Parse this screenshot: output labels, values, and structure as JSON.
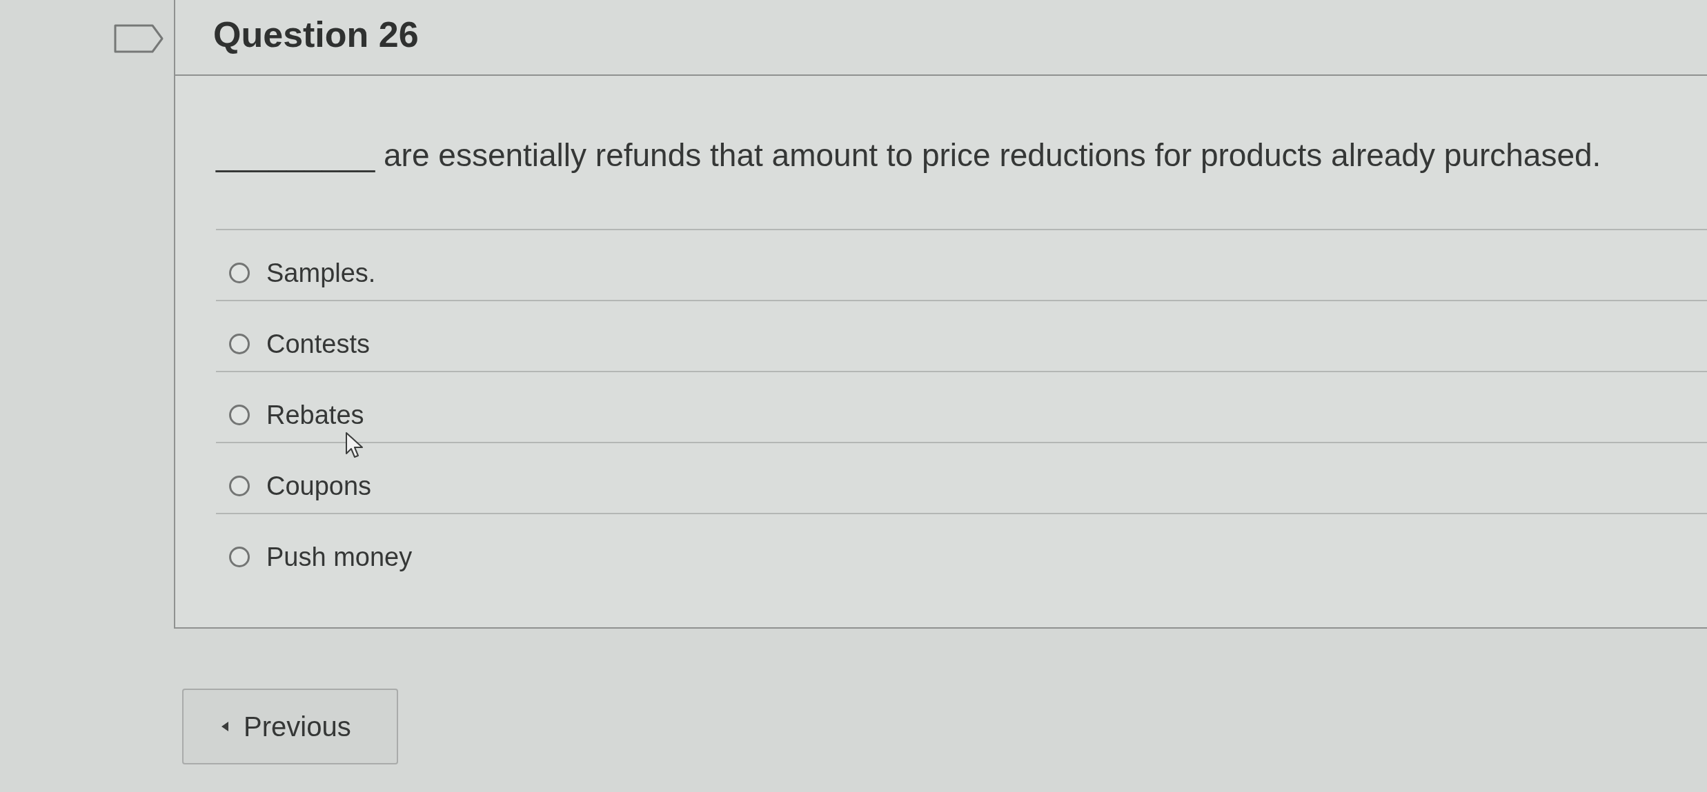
{
  "question": {
    "title": "Question 26",
    "text": "_________ are essentially refunds that amount to price reductions for products already purchased.",
    "options": [
      {
        "label": "Samples.",
        "selected": false
      },
      {
        "label": "Contests",
        "selected": false
      },
      {
        "label": "Rebates",
        "selected": false
      },
      {
        "label": "Coupons",
        "selected": false
      },
      {
        "label": "Push money",
        "selected": false
      }
    ]
  },
  "navigation": {
    "previous": "Previous"
  }
}
